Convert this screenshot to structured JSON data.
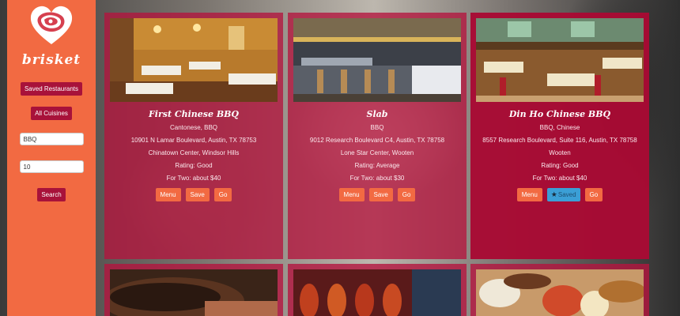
{
  "sidebar": {
    "brand": "brisket",
    "saved_restaurants_label": "Saved Restaurants",
    "all_cuisines_label": "All Cuisines",
    "query_value": "BBQ",
    "radius_value": "10",
    "search_label": "Search"
  },
  "colors": {
    "sidebar": "#f26a42",
    "card": "#b4143e",
    "button": "#f26a42",
    "saved_button": "#3b9fd6",
    "sidebar_button": "#a8123a"
  },
  "restaurants": [
    {
      "name": "First Chinese BBQ",
      "cuisines": "Cantonese, BBQ",
      "address": "10901 N Lamar Boulevard, Austin, TX 78753",
      "locality": "Chinatown Center, Windsor Hills",
      "rating": "Rating: Good",
      "cost": "For Two: about $40",
      "menu_label": "Menu",
      "save_label": "Save",
      "go_label": "Go"
    },
    {
      "name": "Slab",
      "cuisines": "BBQ",
      "address": "9012 Research Boulevard C4, Austin, TX 78758",
      "locality": "Lone Star Center, Wooten",
      "rating": "Rating: Average",
      "cost": "For Two: about $30",
      "menu_label": "Menu",
      "save_label": "Save",
      "go_label": "Go"
    },
    {
      "name": "Din Ho Chinese BBQ",
      "cuisines": "BBQ, Chinese",
      "address": "8557 Research Boulevard, Suite 116, Austin, TX 78758",
      "locality": "Wooten",
      "rating": "Rating: Good",
      "cost": "For Two: about $40",
      "menu_label": "Menu",
      "save_label": "Saved",
      "go_label": "Go",
      "saved": true
    }
  ],
  "icons": {
    "logo": "heart-meat-logo",
    "saved_star": "star-icon"
  }
}
